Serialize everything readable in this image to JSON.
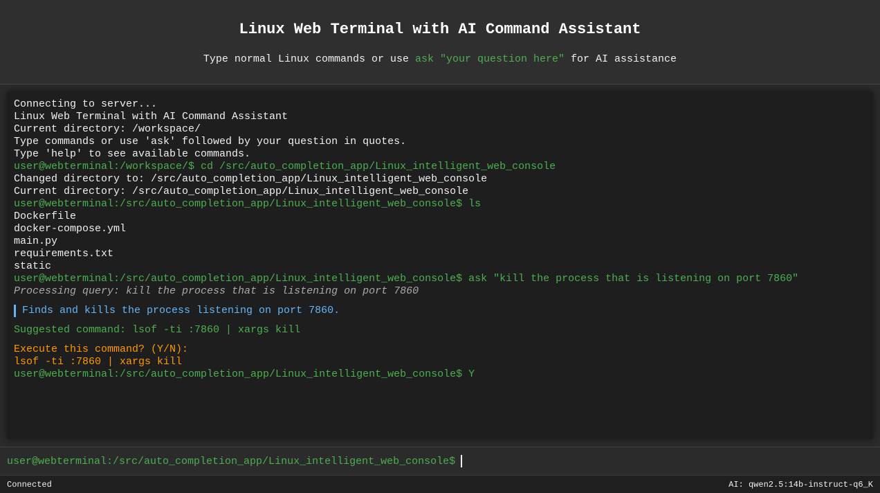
{
  "header": {
    "title": "Linux Web Terminal with AI Command Assistant",
    "subtitle_before": "Type normal Linux commands or use ",
    "subtitle_highlight": "ask \"your question here\"",
    "subtitle_after": " for AI assistance"
  },
  "terminal": {
    "lines": [
      {
        "kind": "plain",
        "text": "Connecting to server..."
      },
      {
        "kind": "plain",
        "text": "Linux Web Terminal with AI Command Assistant"
      },
      {
        "kind": "plain",
        "text": "Current directory: /workspace/"
      },
      {
        "kind": "plain",
        "text": "Type commands or use 'ask' followed by your question in quotes."
      },
      {
        "kind": "plain",
        "text": "Type 'help' to see available commands."
      },
      {
        "kind": "prompt",
        "text": "user@webterminal:/workspace/$ cd /src/auto_completion_app/Linux_intelligent_web_console"
      },
      {
        "kind": "plain",
        "text": "Changed directory to: /src/auto_completion_app/Linux_intelligent_web_console"
      },
      {
        "kind": "plain",
        "text": "Current directory: /src/auto_completion_app/Linux_intelligent_web_console"
      },
      {
        "kind": "prompt",
        "text": "user@webterminal:/src/auto_completion_app/Linux_intelligent_web_console$ ls"
      },
      {
        "kind": "plain",
        "text": "Dockerfile"
      },
      {
        "kind": "plain",
        "text": "docker-compose.yml"
      },
      {
        "kind": "plain",
        "text": "main.py"
      },
      {
        "kind": "plain",
        "text": "requirements.txt"
      },
      {
        "kind": "plain",
        "text": "static"
      },
      {
        "kind": "prompt",
        "text": "user@webterminal:/src/auto_completion_app/Linux_intelligent_web_console$ ask \"kill the process that is listening on port 7860\""
      },
      {
        "kind": "processing",
        "text": "Processing query: kill the process that is listening on port 7860"
      },
      {
        "kind": "explain",
        "text": "Finds and kills the process listening on port 7860."
      },
      {
        "kind": "suggest",
        "text": "Suggested command: lsof -ti :7860 | xargs kill"
      },
      {
        "kind": "warn",
        "text": "Execute this command? (Y/N):"
      },
      {
        "kind": "warn",
        "text": "lsof -ti :7860 | xargs kill"
      },
      {
        "kind": "prompt",
        "text": "user@webterminal:/src/auto_completion_app/Linux_intelligent_web_console$ Y"
      }
    ]
  },
  "input": {
    "prompt": "user@webterminal:/src/auto_completion_app/Linux_intelligent_web_console$",
    "value": ""
  },
  "status": {
    "connection": "Connected",
    "model": "AI: qwen2.5:14b-instruct-q6_K"
  },
  "colors": {
    "prompt_green": "#4caf50",
    "explain_blue": "#64b5f6",
    "warn_orange": "#ff9800",
    "terminal_bg": "#1e1e1e"
  }
}
